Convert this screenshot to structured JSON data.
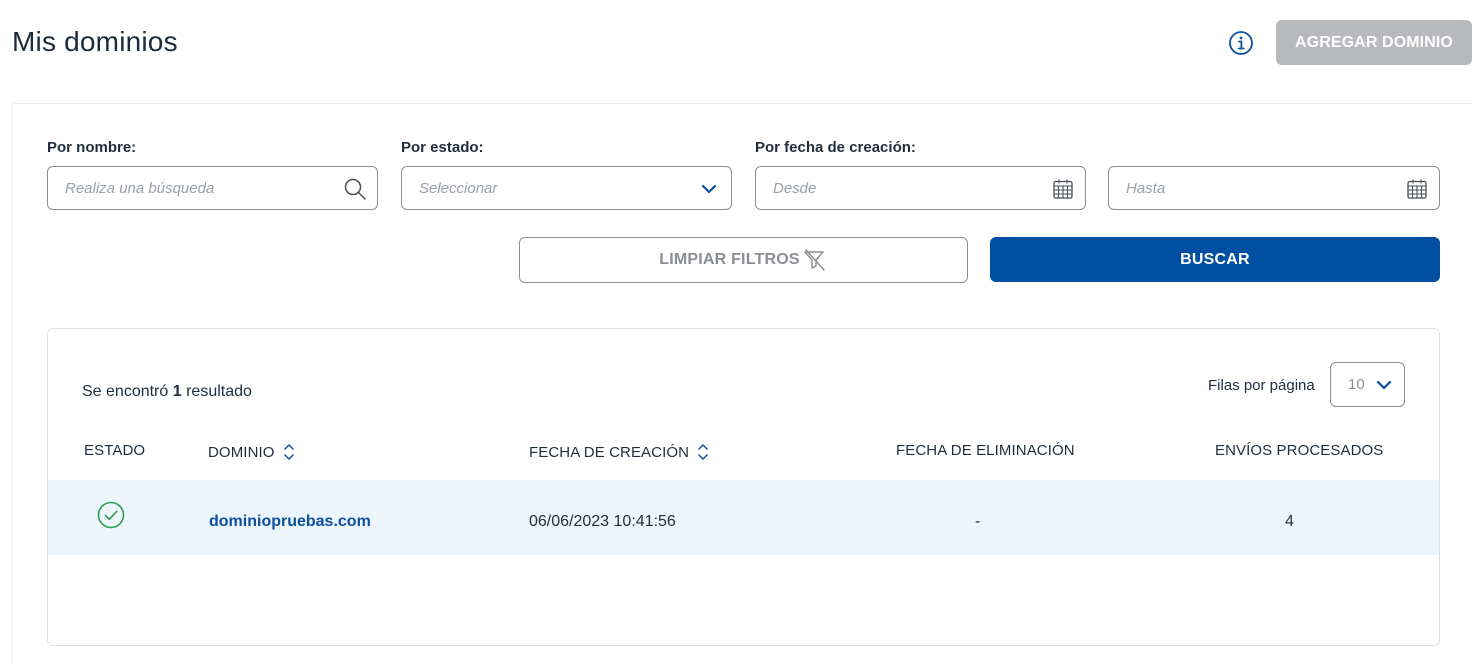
{
  "header": {
    "title": "Mis dominios",
    "add_button": "AGREGAR DOMINIO",
    "add_button_color": "#b7b9bc",
    "info_icon": "info-circle-icon"
  },
  "filters": {
    "name": {
      "label": "Por nombre:",
      "placeholder": "Realiza una búsqueda",
      "icon": "search-icon"
    },
    "status": {
      "label": "Por estado:",
      "placeholder": "Seleccionar",
      "icon": "chevron-down-icon"
    },
    "date": {
      "label": "Por fecha de creación:",
      "from_placeholder": "Desde",
      "to_placeholder": "Hasta",
      "icon": "calendar-icon"
    },
    "clear_button": "LIMPIAR FILTROS",
    "clear_icon": "filter-off-icon",
    "search_button": "BUSCAR",
    "search_button_color": "#004fa3"
  },
  "results": {
    "count_prefix": "Se encontró",
    "count": "1",
    "count_suffix": "resultado",
    "rows_per_page_label": "Filas por página",
    "rows_per_page_value": "10",
    "columns": {
      "estado": "ESTADO",
      "dominio": "DOMINIO",
      "fecha_creacion": "FECHA DE CREACIÓN",
      "fecha_eliminacion": "FECHA DE ELIMINACIÓN",
      "envios": "ENVÍOS PROCESADOS"
    },
    "rows": [
      {
        "status_icon": "check-circle-icon",
        "status_color": "#2e9e4f",
        "domain": "dominiopruebas.com",
        "created": "06/06/2023 10:41:56",
        "deleted": "-",
        "processed": "4"
      }
    ]
  }
}
